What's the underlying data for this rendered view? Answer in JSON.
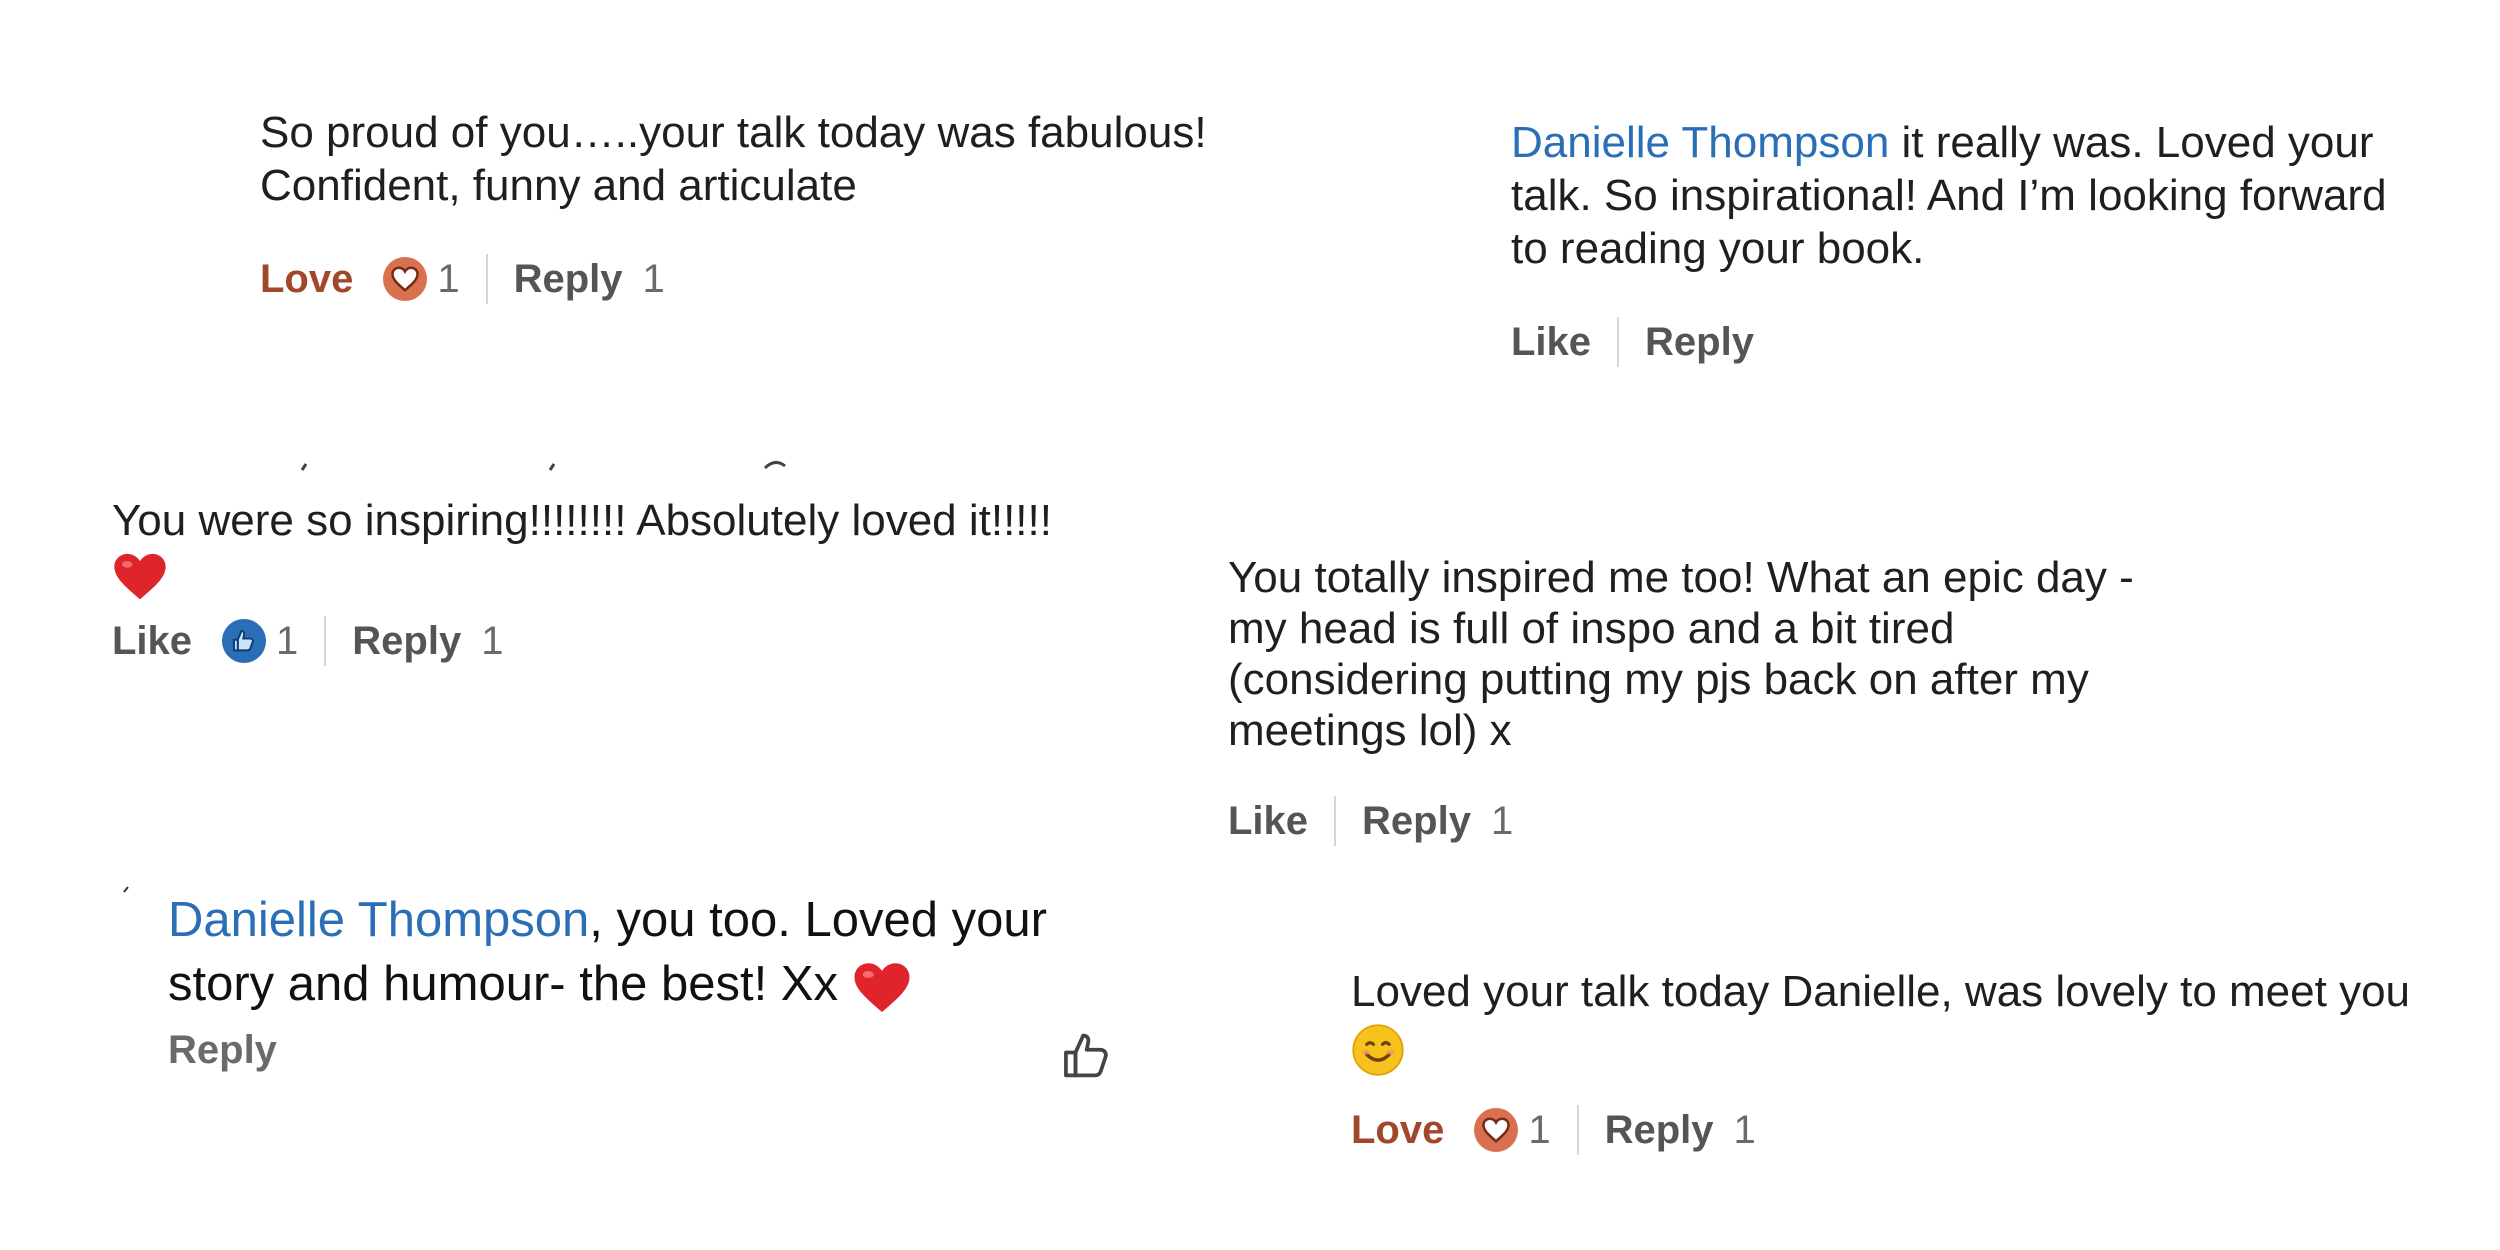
{
  "comments": [
    {
      "text": "So proud of you…..your talk today was fabulous! Confident, funny and articulate",
      "actions": {
        "react_label": "Love",
        "reaction_type": "heart-icon",
        "reaction_count": "1",
        "reply_label": "Reply",
        "reply_count": "1"
      }
    },
    {
      "mention": "Danielle Thompson",
      "text": " it really was. Loved your talk. So inspirational! And I’m looking forward to reading your book.",
      "actions": {
        "react_label": "Like",
        "reply_label": "Reply"
      }
    },
    {
      "text": "You were so inspiring!!!!!!!! Absolutely loved it!!!!!",
      "emoji": "red-heart-emoji",
      "actions": {
        "react_label": "Like",
        "reaction_type": "thumbs-up-icon",
        "reaction_count": "1",
        "reply_label": "Reply",
        "reply_count": "1"
      }
    },
    {
      "text": "You totally inspired me too! What an epic day - my head is full of inspo and a bit tired (considering putting my pjs back on after my meetings lol) x",
      "actions": {
        "react_label": "Like",
        "reply_label": "Reply",
        "reply_count": "1"
      }
    },
    {
      "mention": "Danielle Thompson",
      "text": ", you too.  Loved your story and humour- the best! Xx",
      "emoji": "red-heart-emoji",
      "actions": {
        "reply_label": "Reply",
        "like_icon": "thumbs-up-outline-icon"
      }
    },
    {
      "text": "Loved your talk today Danielle, was lovely to meet you",
      "emoji": "smiling-face-emoji",
      "actions": {
        "react_label": "Love",
        "reaction_type": "heart-icon",
        "reaction_count": "1",
        "reply_label": "Reply",
        "reply_count": "1"
      }
    }
  ],
  "colors": {
    "mention": "#2a6fb5",
    "love": "#a2482a",
    "like_badge": "#2a6fb5",
    "heart_badge": "#d9704f",
    "heart_emoji": "#e0242c",
    "text": "#1f1f1f",
    "action": "#555555"
  }
}
